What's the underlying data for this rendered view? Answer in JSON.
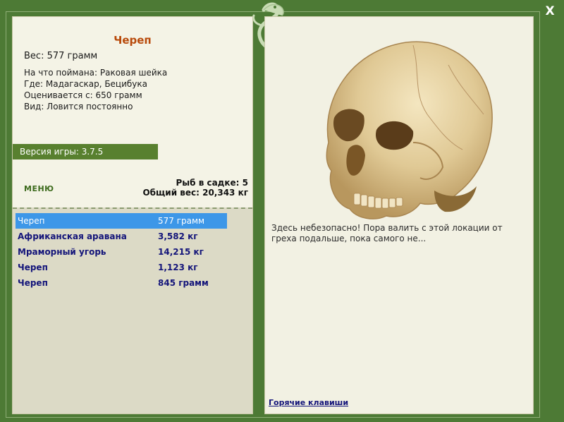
{
  "window": {
    "close_label": "X"
  },
  "fish": {
    "title": "Череп",
    "weight_line": "Вес: 577 грамм",
    "info_lines": [
      "На что поймана: Раковая шейка",
      "Где: Мадагаскар, Бецибука",
      "Оценивается с: 650 грамм",
      "Вид: Ловится постоянно"
    ]
  },
  "game": {
    "version_label": "Версия игры: 3.7.5",
    "menu_label": "МЕНЮ"
  },
  "cage": {
    "fish_count_label": "Рыб в садке: 5",
    "total_weight_label": "Общий вес: 20,343 кг"
  },
  "catch_list": [
    {
      "name": "Череп",
      "weight": "577 грамм"
    },
    {
      "name": "Африканская аравана",
      "weight": "3,582 кг"
    },
    {
      "name": "Мраморный угорь",
      "weight": "14,215 кг"
    },
    {
      "name": "Череп",
      "weight": "1,123 кг"
    },
    {
      "name": "Череп",
      "weight": "845 грамм"
    }
  ],
  "selected_index": 0,
  "message": "Здесь небезопасно! Пора валить с этой локации от греха подальше, пока самого не...",
  "hotkeys_label": "Горячие клавиши",
  "colors": {
    "frame": "#4d7a35",
    "title": "#b84a0b",
    "selection": "#3d97e8",
    "list_text": "#14157a"
  }
}
